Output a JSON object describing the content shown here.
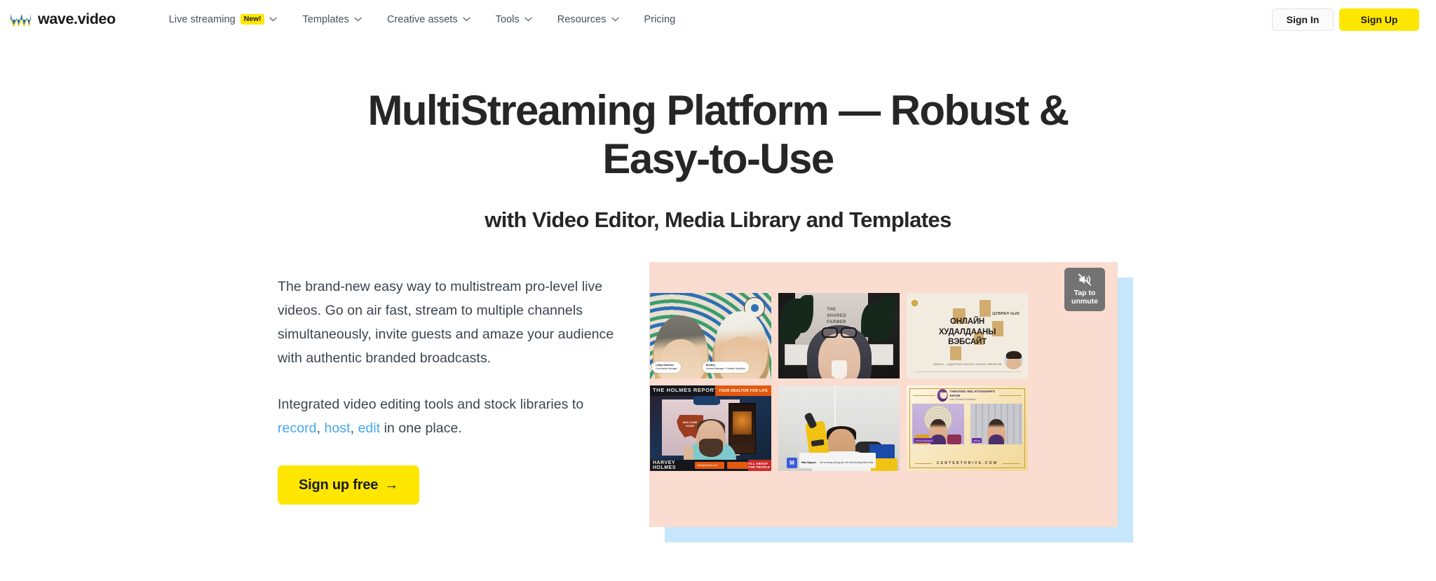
{
  "header": {
    "logo": {
      "text": "wave.video",
      "icon": "wave-logo-icon"
    },
    "nav": [
      {
        "label": "Live streaming",
        "badge": "New!",
        "has_chevron": true
      },
      {
        "label": "Templates",
        "badge": null,
        "has_chevron": true
      },
      {
        "label": "Creative assets",
        "badge": null,
        "has_chevron": true
      },
      {
        "label": "Tools",
        "badge": null,
        "has_chevron": true
      },
      {
        "label": "Resources",
        "badge": null,
        "has_chevron": true
      },
      {
        "label": "Pricing",
        "badge": null,
        "has_chevron": false
      }
    ],
    "sign_in": "Sign In",
    "sign_up": "Sign Up"
  },
  "hero": {
    "title": "MultiStreaming Platform — Robust & Easy-to-Use",
    "subtitle": "with Video Editor, Media Library and Templates",
    "paragraph_1": "The brand-new easy way to multistream pro-level live videos. Go on air fast, stream to multiple channels simultaneously, invite guests and amaze your audience with authentic branded broadcasts.",
    "paragraph_2_prefix": "Integrated video editing tools and stock libraries to ",
    "link_record": "record",
    "sep_1": ", ",
    "link_host": "host",
    "sep_2": ", ",
    "link_edit": "edit",
    "paragraph_2_suffix": " in one place.",
    "cta": "Sign up free",
    "cta_arrow": "→"
  },
  "media": {
    "unmute": {
      "line1": "Tap to",
      "line2": "unmute",
      "icon": "muted-speaker-icon"
    },
    "tiles": [
      {
        "id": "tile-two-women",
        "name_tag_1": "Lidiya Hartmes",
        "role_tag_1": "Community Manager",
        "name_tag_2": "Bentley",
        "role_tag_2": "Account Manager / Creative Discipline"
      },
      {
        "id": "tile-woman-glasses",
        "wall_sign": "THE SHARED FARMER"
      },
      {
        "id": "tile-mongolian-slide",
        "heading_line1": "ОНЛАЙН",
        "heading_line2": "ХУДАЛДААНЫ",
        "heading_line3": "ВЭБСАЙТ",
        "number": "ЦУВРАЛ №20",
        "footnote": "ЗӨВЛӨХ : ЧАДВАРТАЙ ХАМТЫН ХӨГЖИЛ ЗӨВЛӨГӨӨ"
      },
      {
        "id": "tile-holmes-report",
        "show_title": "THE HOLMES REPORT",
        "corner_tag": "YOUR REALTOR FOR LIFE",
        "lower_third": "HARVEY HOLMES",
        "chip_1": "harveyholmes.com",
        "chip_2": "Facebook",
        "badge": "ALL ABOUT THE PEOPLE",
        "texas_text": "WELCOME HOME"
      },
      {
        "id": "tile-man-tool",
        "chat_avatar": "M",
        "chat_name": "Mau Nguyen",
        "chat_message": "mở ra dùng chung pin với các thương hiệu khác"
      },
      {
        "id": "tile-thriving-relationships",
        "show_title": "THRIVING RELATIONSHIPS SHOW",
        "show_host": "with Christine Bartlanzi",
        "guest_tag_1": "Christine Bartlanzi",
        "guest_role_1": "CEO",
        "guest_tag_2": "Michell",
        "guest_role_2": "CEO & Co-Founder, Up Grade",
        "website": "CENTERTHRIVE.COM"
      }
    ]
  },
  "colors": {
    "brand_yellow": "#ffe600",
    "link_blue": "#44a8f2",
    "hero_panel": "#fbdcd0",
    "accent_blue": "#c5e6fb",
    "text_dark": "#262626",
    "text_body": "#3b444f",
    "nav_text": "#45505e"
  }
}
